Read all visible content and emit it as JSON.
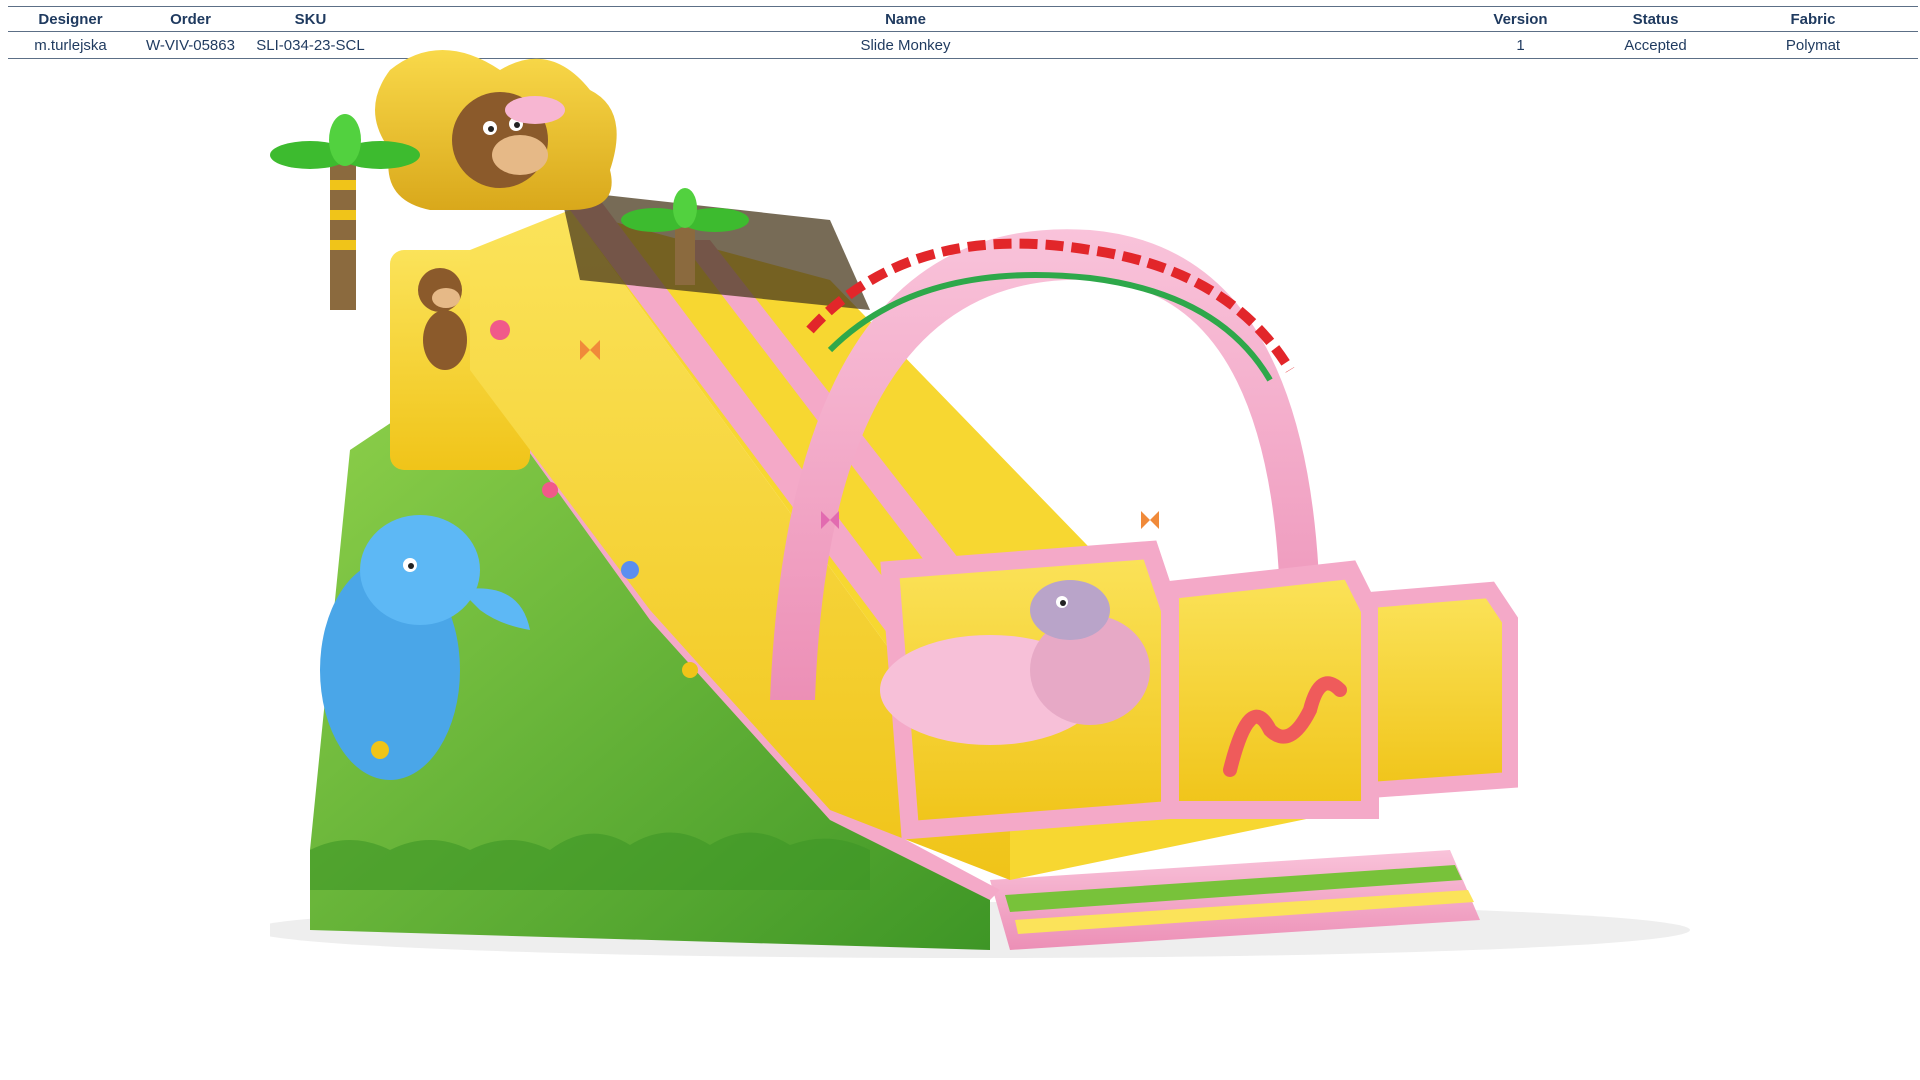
{
  "spec_table": {
    "headers": {
      "designer": "Designer",
      "order": "Order",
      "sku": "SKU",
      "name": "Name",
      "version": "Version",
      "status": "Status",
      "fabric": "Fabric"
    },
    "row": {
      "designer": "m.turlejska",
      "order": "W-VIV-05863",
      "sku": "SLI-034-23-SCL",
      "name": "Slide Monkey",
      "version": "1",
      "status": "Accepted",
      "fabric": "Polymat"
    }
  },
  "colors": {
    "header_text": "#1f3a5f",
    "rule": "#5c6f86",
    "slide_yellow": "#f7d731",
    "slide_pink": "#f4a9c8",
    "slide_green": "#68b82e"
  }
}
